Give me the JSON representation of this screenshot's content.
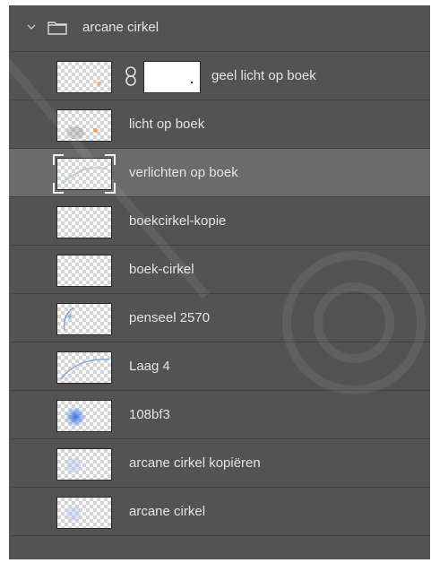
{
  "group": {
    "name": "arcane cirkel",
    "expanded": true
  },
  "layers": [
    {
      "name": "geel licht op boek",
      "has_mask": true,
      "selected": false,
      "thumb": "orange-light"
    },
    {
      "name": "licht op boek",
      "has_mask": false,
      "selected": false,
      "thumb": "orange-light"
    },
    {
      "name": "verlichten op boek",
      "has_mask": false,
      "selected": true,
      "thumb": "light-arc"
    },
    {
      "name": "boekcirkel-kopie",
      "has_mask": false,
      "selected": false,
      "thumb": "empty"
    },
    {
      "name": "boek-cirkel",
      "has_mask": false,
      "selected": false,
      "thumb": "empty"
    },
    {
      "name": "penseel 2570",
      "has_mask": false,
      "selected": false,
      "thumb": "blue-arc"
    },
    {
      "name": "Laag 4",
      "has_mask": false,
      "selected": false,
      "thumb": "blue-arc"
    },
    {
      "name": "108bf3",
      "has_mask": false,
      "selected": false,
      "thumb": "blue-glow"
    },
    {
      "name": "arcane cirkel  kopiëren",
      "has_mask": false,
      "selected": false,
      "thumb": "faint-blue"
    },
    {
      "name": "arcane cirkel",
      "has_mask": false,
      "selected": false,
      "thumb": "faint-blue"
    }
  ],
  "colors": {
    "panel": "#535353",
    "selected_row": "#6b6b6b",
    "divider": "#414141",
    "text": "#e4e4e4"
  },
  "icons": {
    "expand": "chevron-down-icon",
    "group": "folder-icon",
    "link": "chain-link-icon"
  }
}
